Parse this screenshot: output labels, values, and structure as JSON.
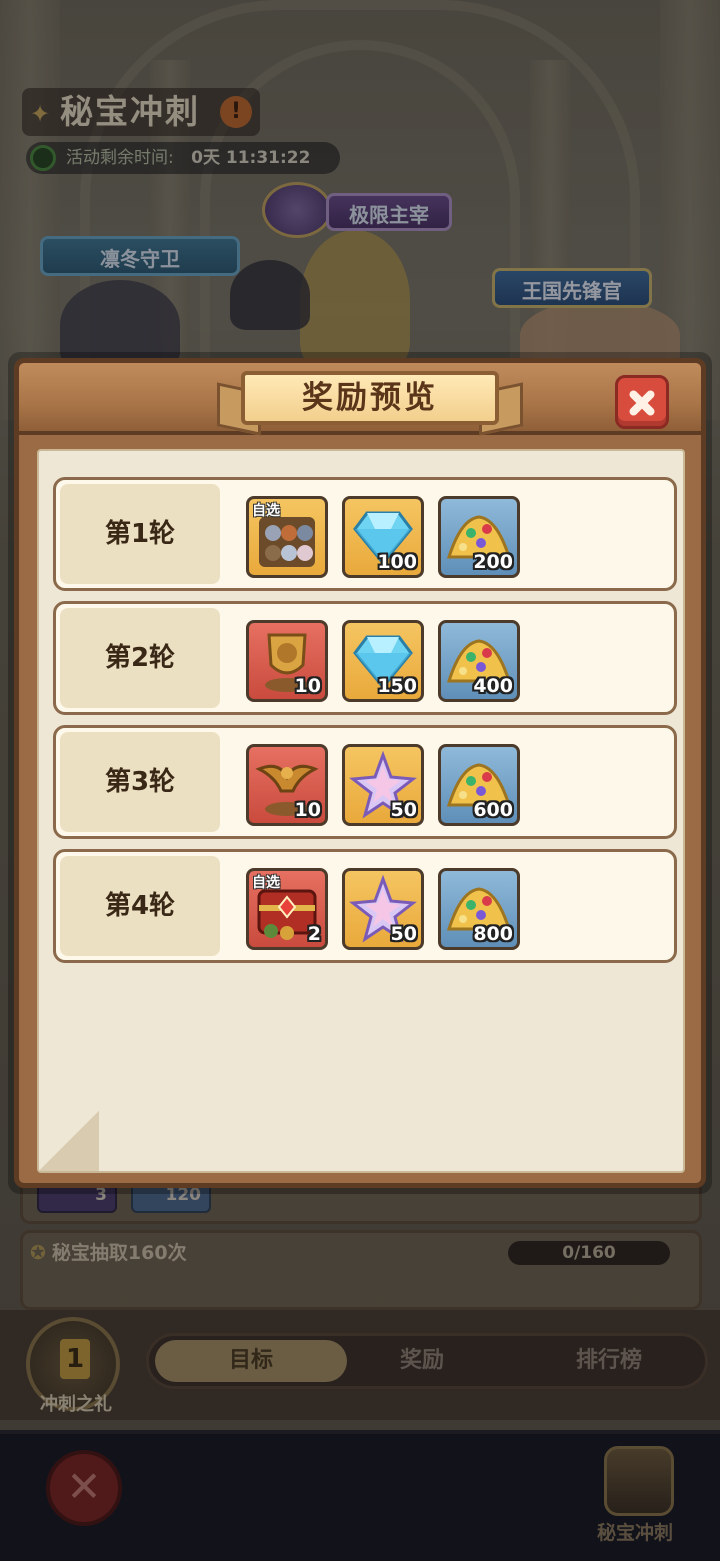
{
  "event": {
    "title": "秘宝冲刺",
    "timer_label": "活动剩余时间:",
    "timer_value": "0天 11:31:22"
  },
  "banners": {
    "left": "凛冬守卫",
    "center": "极限主宰",
    "right": "王国先锋官"
  },
  "underlay": {
    "task_label": "秘宝抽取160次",
    "task_progress": "0/160",
    "partial_values": [
      "3",
      "120"
    ]
  },
  "tabs": [
    {
      "label": "目标",
      "active": true
    },
    {
      "label": "奖励",
      "active": false
    },
    {
      "label": "排行榜",
      "active": false
    }
  ],
  "sprint_gift": {
    "label": "冲刺之礼",
    "rank": "1"
  },
  "bottom_bar": {
    "right_label": "秘宝冲刺"
  },
  "modal": {
    "title": "奖励预览",
    "rows": [
      {
        "label": "第1轮",
        "items": [
          {
            "icon": "hero-selection-pack-icon",
            "tag": "自选",
            "qty": "",
            "bg": "gold"
          },
          {
            "icon": "diamond-icon",
            "tag": "",
            "qty": "100",
            "bg": "gold"
          },
          {
            "icon": "gold-pile-icon",
            "tag": "",
            "qty": "200",
            "bg": "blue"
          }
        ]
      },
      {
        "label": "第2轮",
        "items": [
          {
            "icon": "lion-shield-trophy-icon",
            "tag": "",
            "qty": "10",
            "bg": "red"
          },
          {
            "icon": "diamond-icon",
            "tag": "",
            "qty": "150",
            "bg": "gold"
          },
          {
            "icon": "gold-pile-icon",
            "tag": "",
            "qty": "400",
            "bg": "blue"
          }
        ]
      },
      {
        "label": "第3轮",
        "items": [
          {
            "icon": "eagle-trophy-icon",
            "tag": "",
            "qty": "10",
            "bg": "red"
          },
          {
            "icon": "star-crystal-icon",
            "tag": "",
            "qty": "50",
            "bg": "gold"
          },
          {
            "icon": "gold-pile-icon",
            "tag": "",
            "qty": "600",
            "bg": "blue"
          }
        ]
      },
      {
        "label": "第4轮",
        "items": [
          {
            "icon": "selection-chest-icon",
            "tag": "自选",
            "qty": "2",
            "bg": "red"
          },
          {
            "icon": "star-crystal-icon",
            "tag": "",
            "qty": "50",
            "bg": "gold"
          },
          {
            "icon": "gold-pile-icon",
            "tag": "",
            "qty": "800",
            "bg": "blue"
          }
        ]
      }
    ]
  }
}
